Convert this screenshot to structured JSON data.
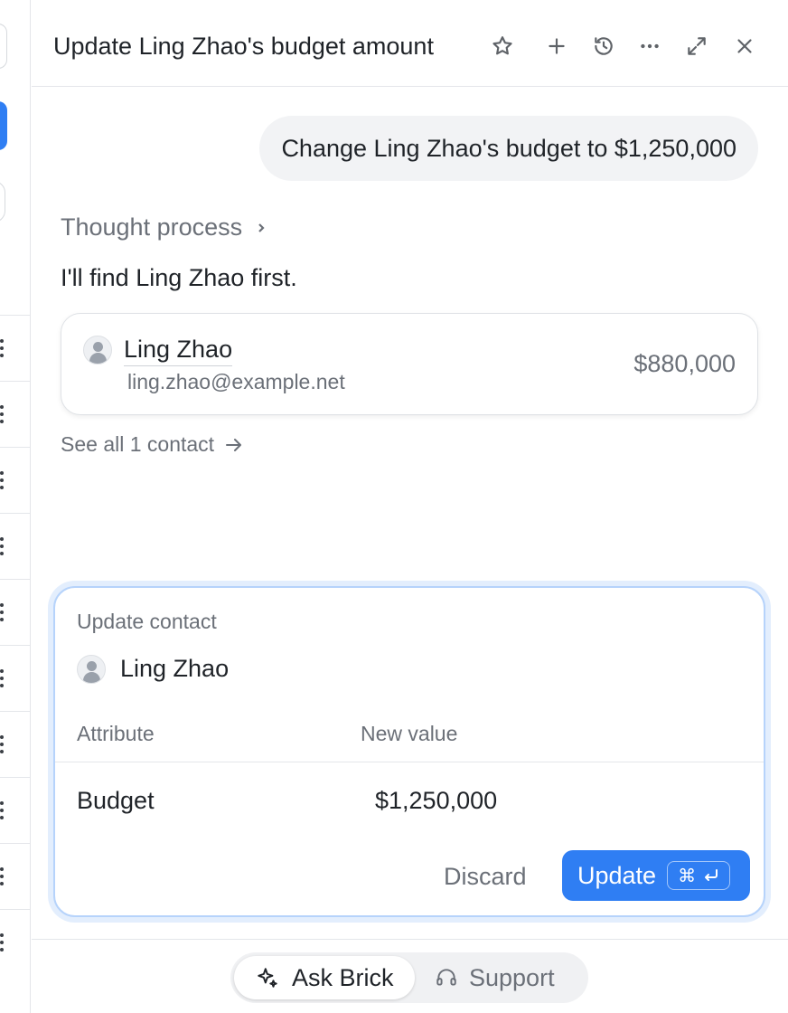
{
  "panel": {
    "title": "Update Ling Zhao's budget amount",
    "header_icons": [
      "star-icon",
      "plus-icon",
      "history-icon",
      "more-icon",
      "expand-icon",
      "close-icon"
    ]
  },
  "chat": {
    "user_message": "Change Ling Zhao's budget to $1,250,000",
    "thought_label": "Thought process",
    "assistant_reply": "I'll find Ling Zhao first.",
    "contact": {
      "name": "Ling Zhao",
      "email": "ling.zhao@example.net",
      "budget": "$880,000"
    },
    "see_all": "See all 1 contact"
  },
  "update_card": {
    "label": "Update contact",
    "contact_name": "Ling Zhao",
    "col_attribute": "Attribute",
    "col_new_value": "New value",
    "attribute": "Budget",
    "new_value": "$1,250,000",
    "discard_label": "Discard",
    "update_label": "Update",
    "shortcut_symbol": "⌘"
  },
  "footer": {
    "ask_label": "Ask Brick",
    "support_label": "Support"
  },
  "colors": {
    "accent": "#2f7ef3",
    "card_focus_border": "#b6d3fb",
    "muted_text": "#6b7078"
  }
}
